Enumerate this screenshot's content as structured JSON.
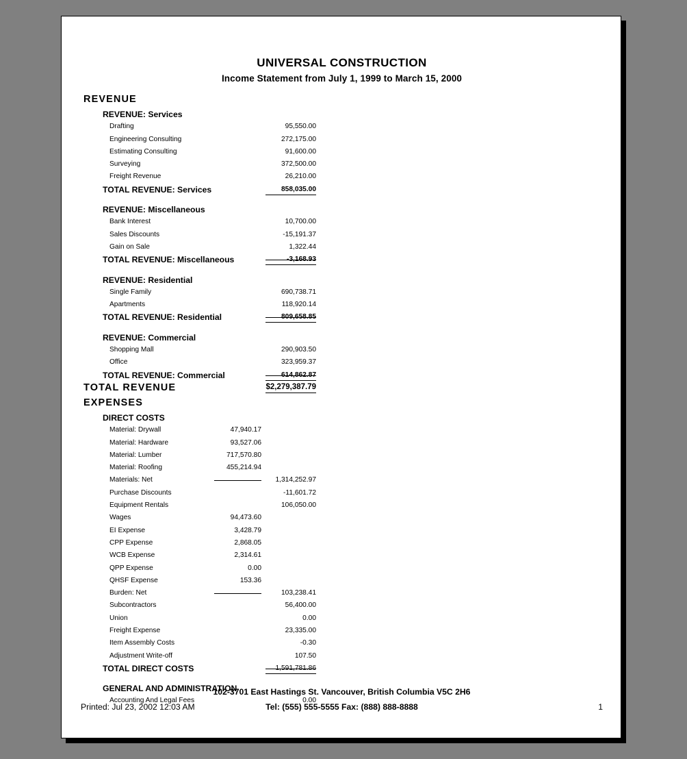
{
  "document": {
    "title": "UNIVERSAL CONSTRUCTION",
    "subtitle": "Income Statement from July 1, 1999 to March 15, 2000"
  },
  "footer": {
    "address": "102-3701 East Hastings St.  Vancouver, British Columbia  V5C 2H6",
    "printed": "Printed: Jul 23, 2002 12:03 AM",
    "phone": "Tel: (555) 555-5555  Fax: (888) 888-8888",
    "page_number": "1"
  },
  "statement": {
    "rows": [
      {
        "level": "section",
        "label": "REVENUE"
      },
      {
        "level": "group",
        "label": "REVENUE: Services"
      },
      {
        "level": "item",
        "label": "Drafting",
        "colB": "95,550.00"
      },
      {
        "level": "item",
        "label": "Engineering Consulting",
        "colB": "272,175.00"
      },
      {
        "level": "item",
        "label": "Estimating Consulting",
        "colB": "91,600.00"
      },
      {
        "level": "item",
        "label": "Surveying",
        "colB": "372,500.00"
      },
      {
        "level": "item",
        "label": "Freight Revenue",
        "colB": "26,210.00"
      },
      {
        "level": "total",
        "label": "TOTAL REVENUE: Services",
        "colB": "858,035.00",
        "ruleB": "bottom"
      },
      {
        "level": "gap"
      },
      {
        "level": "group",
        "label": "REVENUE: Miscellaneous"
      },
      {
        "level": "item",
        "label": "Bank Interest",
        "colB": "10,700.00"
      },
      {
        "level": "item",
        "label": "Sales Discounts",
        "colB": "-15,191.37"
      },
      {
        "level": "item",
        "label": "Gain on Sale",
        "colB": "1,322.44"
      },
      {
        "level": "total",
        "label": "TOTAL REVENUE: Miscellaneous",
        "colB": "-3,168.93",
        "ruleB": "both"
      },
      {
        "level": "gap"
      },
      {
        "level": "group",
        "label": "REVENUE: Residential"
      },
      {
        "level": "item",
        "label": "Single Family",
        "colB": "690,738.71"
      },
      {
        "level": "item",
        "label": "Apartments",
        "colB": "118,920.14"
      },
      {
        "level": "total",
        "label": "TOTAL REVENUE: Residential",
        "colB": "809,658.85",
        "ruleB": "both"
      },
      {
        "level": "gap"
      },
      {
        "level": "group",
        "label": "REVENUE: Commercial"
      },
      {
        "level": "item",
        "label": "Shopping Mall",
        "colB": "290,903.50"
      },
      {
        "level": "item",
        "label": "Office",
        "colB": "323,959.37"
      },
      {
        "level": "total",
        "label": "TOTAL REVENUE: Commercial",
        "colB": "614,862.87",
        "ruleB": "both"
      },
      {
        "level": "grand",
        "label": "TOTAL REVENUE",
        "colB": "$2,279,387.79",
        "ruleB": "bottom"
      },
      {
        "level": "section",
        "label": "EXPENSES"
      },
      {
        "level": "group",
        "label": "DIRECT COSTS"
      },
      {
        "level": "item",
        "label": "Material: Drywall",
        "colA": "47,940.17"
      },
      {
        "level": "item",
        "label": "Material: Hardware",
        "colA": "93,527.06"
      },
      {
        "level": "item",
        "label": "Material: Lumber",
        "colA": "717,570.80"
      },
      {
        "level": "item",
        "label": "Material: Roofing",
        "colA": "455,214.94"
      },
      {
        "level": "item",
        "label": "Materials: Net",
        "colB": "1,314,252.97",
        "ruleA": "mid"
      },
      {
        "level": "item",
        "label": "Purchase Discounts",
        "colB": "-11,601.72"
      },
      {
        "level": "item",
        "label": "Equipment Rentals",
        "colB": "106,050.00"
      },
      {
        "level": "item",
        "label": "Wages",
        "colA": "94,473.60"
      },
      {
        "level": "item",
        "label": "EI Expense",
        "colA": "3,428.79"
      },
      {
        "level": "item",
        "label": "CPP Expense",
        "colA": "2,868.05"
      },
      {
        "level": "item",
        "label": "WCB Expense",
        "colA": "2,314.61"
      },
      {
        "level": "item",
        "label": "QPP Expense",
        "colA": "0.00"
      },
      {
        "level": "item",
        "label": "QHSF Expense",
        "colA": "153.36"
      },
      {
        "level": "item",
        "label": "Burden: Net",
        "colB": "103,238.41",
        "ruleA": "mid"
      },
      {
        "level": "item",
        "label": "Subcontractors",
        "colB": "56,400.00"
      },
      {
        "level": "item",
        "label": "Union",
        "colB": "0.00"
      },
      {
        "level": "item",
        "label": "Freight Expense",
        "colB": "23,335.00"
      },
      {
        "level": "item",
        "label": "Item Assembly Costs",
        "colB": "-0.30"
      },
      {
        "level": "item",
        "label": "Adjustment Write-off",
        "colB": "107.50"
      },
      {
        "level": "total",
        "label": "TOTAL DIRECT COSTS",
        "colB": "1,591,781.86",
        "plainAmount": true,
        "ruleB": "both"
      },
      {
        "level": "gap"
      },
      {
        "level": "group",
        "label": "GENERAL AND ADMINISTRATION"
      },
      {
        "level": "item",
        "label": "Accounting And Legal Fees",
        "colB": "0.00"
      }
    ]
  }
}
